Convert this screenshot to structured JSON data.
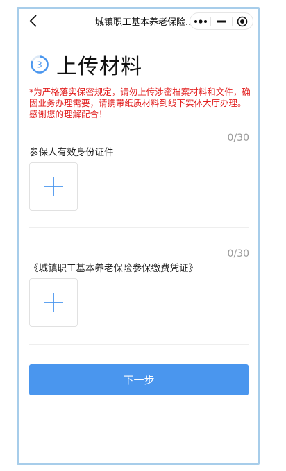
{
  "nav": {
    "title": "城镇职工基本养老保险..."
  },
  "header": {
    "step_number": "3",
    "title": "上传材料"
  },
  "notice": "*为严格落实保密规定，请勿上传涉密档案材料和文件，确因业务办理需要，请携带纸质材料到线下实体大厅办理。感谢您的理解配合！",
  "sections": [
    {
      "label": "参保人有效身份证件",
      "count": "0/30"
    },
    {
      "label": "《城镇职工基本养老保险参保缴费凭证》",
      "count": "0/30"
    }
  ],
  "next_button": "下一步",
  "colors": {
    "accent": "#4a96ee",
    "notice": "#e21e1e",
    "frame_border": "#a7cdea"
  },
  "icons": {
    "back": "back-arrow-icon",
    "more": "more-dots-icon",
    "minimize": "minimize-icon",
    "close": "close-target-icon",
    "upload": "plus-icon"
  }
}
